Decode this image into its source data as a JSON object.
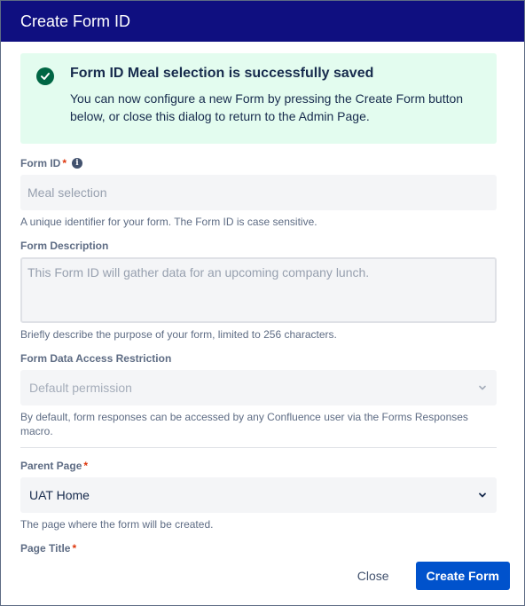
{
  "dialog": {
    "title": "Create Form ID"
  },
  "success": {
    "title": "Form ID Meal selection is successfully saved",
    "message": "You can now configure a new Form by pressing the Create Form button below, or close this dialog to return to the Admin Page."
  },
  "form_id": {
    "label": "Form ID",
    "required_mark": "*",
    "info_icon": "i",
    "placeholder": "Meal selection",
    "help": "A unique identifier for your form. The Form ID is case sensitive."
  },
  "form_description": {
    "label": "Form Description",
    "placeholder": "This Form ID will gather data for an upcoming company lunch.",
    "help": "Briefly describe the purpose of your form, limited to 256 characters."
  },
  "access_restriction": {
    "label": "Form Data Access Restriction",
    "selected": "Default permission",
    "help": "By default, form responses can be accessed by any Confluence user via the Forms Responses macro."
  },
  "parent_page": {
    "label": "Parent Page",
    "required_mark": "*",
    "selected": "UAT Home",
    "help": "The page where the form will be created."
  },
  "page_title": {
    "label": "Page Title",
    "required_mark": "*"
  },
  "footer": {
    "close_label": "Close",
    "create_label": "Create Form"
  },
  "colors": {
    "header_bg": "#0f0f80",
    "success_bg": "#e3fcef",
    "success_icon": "#006644",
    "primary_button": "#0052cc",
    "required": "#de350b"
  },
  "icons": [
    "check-circle-icon",
    "info-icon",
    "chevron-down-icon"
  ]
}
